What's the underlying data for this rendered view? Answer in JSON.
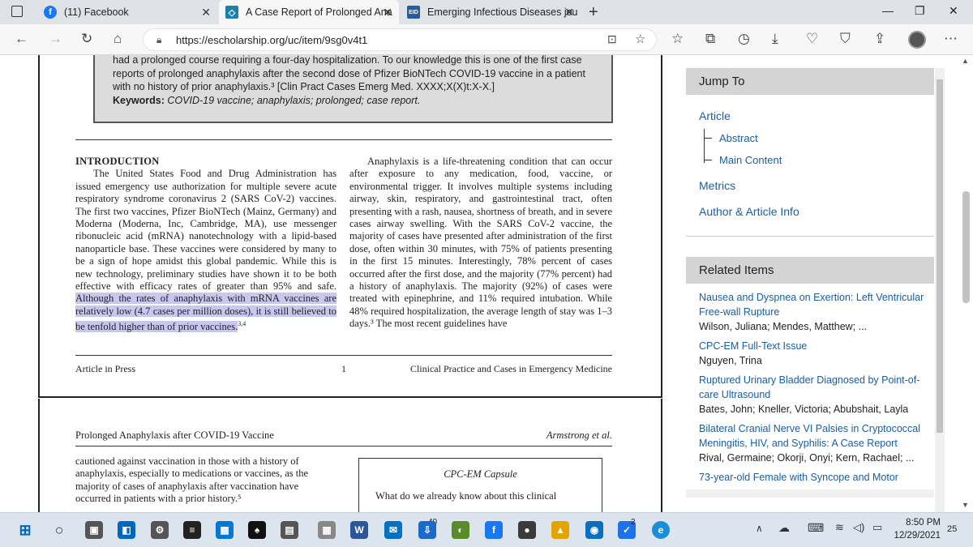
{
  "tabs": [
    {
      "label": "(11) Facebook",
      "close": "✕"
    },
    {
      "label": "A Case Report of Prolonged Ana",
      "close": "✕"
    },
    {
      "label": "Emerging Infectious Diseases jou",
      "close": "✕"
    }
  ],
  "new_tab": "+",
  "window_controls": {
    "minimize": "—",
    "restore": "❐",
    "close": "✕"
  },
  "address_bar": {
    "url": "https://escholarship.org/uc/item/9sg0v4t1"
  },
  "abstract": {
    "text": "had a prolonged course requiring a four-day hospitalization. To our knowledge this is one of the first case reports of prolonged anaphylaxis after the second dose of Pfizer BioNTech COVID-19 vaccine in a patient with no history of prior anaphylaxis.³ [Clin Pract Cases Emerg Med. XXXX;X(X)t:X-X.]",
    "keywords_label": "Keywords:",
    "keywords": "COVID-19 vaccine; anaphylaxis; prolonged; case report."
  },
  "article": {
    "intro_heading": "INTRODUCTION",
    "col1_text": "The United States Food and Drug Administration has issued emergency use authorization for multiple severe acute respiratory syndrome coronavirus 2 (SARS CoV-2) vaccines. The first two vaccines, Pfizer BioNTech (Mainz, Germany) and Moderna (Moderna, Inc, Cambridge, MA), use messenger ribonucleic acid (mRNA) nanotechnology with a lipid-based nanoparticle base. These vaccines were considered by many to be a sign of hope amidst this global pandemic. While this is new technology, preliminary studies have shown it to be both effective with efficacy rates of greater than 95% and safe.",
    "col1_highlight": "Although the rates of anaphylaxis with mRNA vaccines are relatively low (4.7 cases per million doses), it is still believed to be tenfold higher than of prior vaccines.",
    "col1_highlight_ref": "3,4",
    "col2_text": "Anaphylaxis is a life-threatening condition that can occur after exposure to any medication, food, vaccine, or environmental trigger. It involves multiple systems including airway, skin, respiratory, and gastrointestinal tract, often presenting with a rash, nausea, shortness of breath, and in severe cases airway swelling. With the SARS CoV-2 vaccine, the majority of cases have presented after administration of the first dose, often within 30 minutes, with 75% of patients presenting in the first 15 minutes. Interestingly, 78% percent of cases occurred after the first dose, and the majority (77% percent) had a history of anaphylaxis. The majority (92%) of cases were treated with epinephrine, and 11% required intubation. While 48% required hospitalization, the average length of stay was 1–3 days.³ The most recent guidelines have",
    "footer_left": "Article in Press",
    "footer_page": "1",
    "footer_right": "Clinical Practice and Cases in Emergency Medicine",
    "p2_running_title": "Prolonged Anaphylaxis after COVID-19 Vaccine",
    "p2_authors": "Armstrong et al.",
    "p2_col1": "cautioned against vaccination in those with a history of anaphylaxis, especially to medications or vaccines, as the majority of cases of anaphylaxis after vaccination have occurred in patients with a prior history.⁵",
    "capsule_title": "CPC-EM Capsule",
    "capsule_q": "What do we already know about this clinical"
  },
  "sidebar": {
    "jump_to": "Jump To",
    "article": "Article",
    "abstract": "Abstract",
    "main_content": "Main Content",
    "metrics": "Metrics",
    "author_info": "Author & Article Info",
    "related_heading": "Related Items",
    "related": [
      {
        "title": "Nausea and Dyspnea on Exertion: Left Ventricular Free-wall Rupture",
        "authors": "Wilson, Juliana;  Mendes, Matthew;  ..."
      },
      {
        "title": "CPC-EM Full-Text Issue",
        "authors": "Nguyen, Trina"
      },
      {
        "title": "Ruptured Urinary Bladder Diagnosed by Point-of-care Ultrasound",
        "authors": "Bates, John;  Kneller, Victoria;  Abubshait, Layla"
      },
      {
        "title": "Bilateral Cranial Nerve VI Palsies in Cryptococcal Meningitis, HIV, and Syphilis: A Case Report",
        "authors": "Rival, Germaine;  Okorji, Onyi;  Kern, Rachael;  ..."
      },
      {
        "title": "73-year-old Female with Syncope and Motor",
        "authors": ""
      }
    ]
  },
  "taskbar": {
    "mail_badge": "40",
    "edge_badge": "2",
    "time": "8:50 PM",
    "date": "12/29/2021",
    "notif": "25"
  },
  "colors": {
    "highlight": "#c9c6f0",
    "link": "#1a5da6",
    "facebook": "#1877f2"
  }
}
